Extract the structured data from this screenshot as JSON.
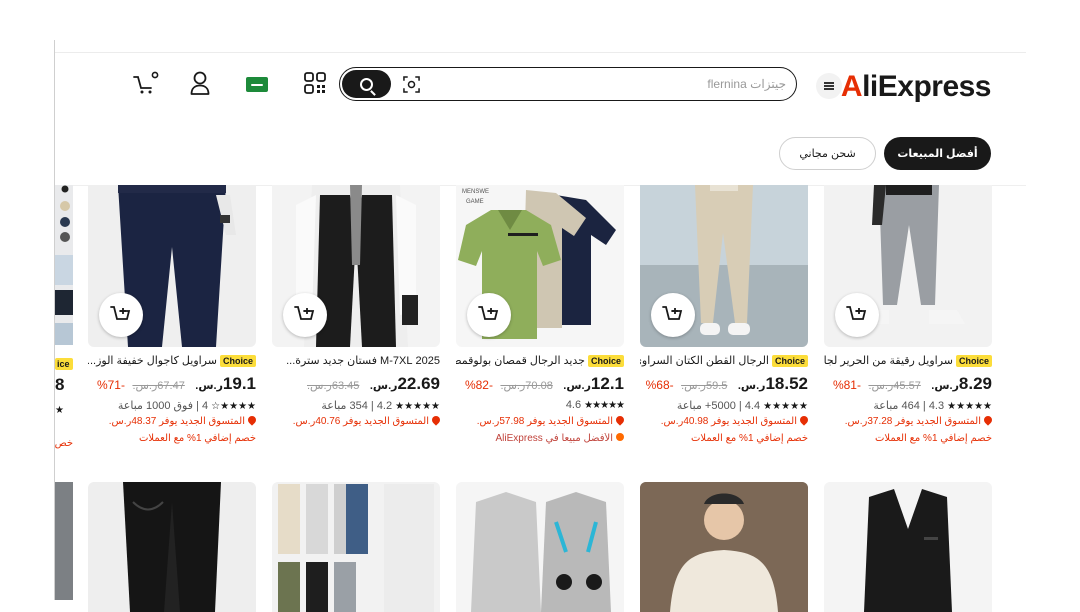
{
  "header": {
    "logo": "AliExpress",
    "search_placeholder": "جيتزات flernina",
    "icons": [
      "menu-icon",
      "search-icon",
      "image-search-icon",
      "qr-code-icon",
      "saudi-flag-icon",
      "user-icon",
      "cart-icon"
    ]
  },
  "filters": {
    "best_sellers": "أفضل المبيعات",
    "free_shipping": "شحن مجاني"
  },
  "colors": {
    "brand": "#e62e04",
    "choice": "#fcdd3a"
  },
  "products": [
    {
      "title": "سراويل رقيقة من الحرير لجا...",
      "choice": "Choice",
      "price": "8.29",
      "currency": "ر.س.",
      "old_price": "45.57ر.س.",
      "discount": "-81%",
      "rating": "4.3",
      "sold": "464 مباعة",
      "promo1": "المتسوق الجديد يوفر 37.28ر.س.",
      "promo2": "خصم إضافي 1% مع العملات"
    },
    {
      "title": "الرجال القطن الكتان السراوي...",
      "choice": "Choice",
      "price": "18.52",
      "currency": "ر.س.",
      "old_price": "59.5ر.س.",
      "discount": "-68%",
      "rating": "4.4",
      "sold": "5000+ مباعة",
      "promo1": "المتسوق الجديد يوفر 40.98ر.س.",
      "promo2": "خصم إضافي 1% مع العملات"
    },
    {
      "title": "جديد الرجال قمصان بولوقمص...",
      "choice": "Choice",
      "price": "12.1",
      "currency": "ر.س.",
      "old_price": "70.08ر.س.",
      "discount": "-82%",
      "rating": "4.6",
      "sold": "",
      "promo1": "المتسوق الجديد يوفر 57.98ر.س.",
      "promo2": "الأفضل مبيعاً في AliExpress"
    },
    {
      "title": "2025 M-7XL فستان جديد سترة...",
      "choice": "",
      "price": "22.69",
      "currency": "ر.س.",
      "old_price": "63.45ر.س.",
      "discount": "",
      "rating": "4.2",
      "sold": "354 مباعة",
      "promo1": "المتسوق الجديد يوفر 40.76ر.س.",
      "promo2": ""
    },
    {
      "title": "سراويل كاجوال خفيفة الوز...",
      "choice": "Choice",
      "price": "19.1",
      "currency": "ر.س.",
      "old_price": "67.47ر.س.",
      "discount": "-71%",
      "rating": "4",
      "sold": "فوق 1000 مباعة",
      "promo1": "المتسوق الجديد يوفر 48.37ر.س.",
      "promo2": "خصم إضافي 1% مع العملات"
    }
  ],
  "partial_column": {
    "choice": "ice",
    "price": "8",
    "promo2": "خص"
  }
}
